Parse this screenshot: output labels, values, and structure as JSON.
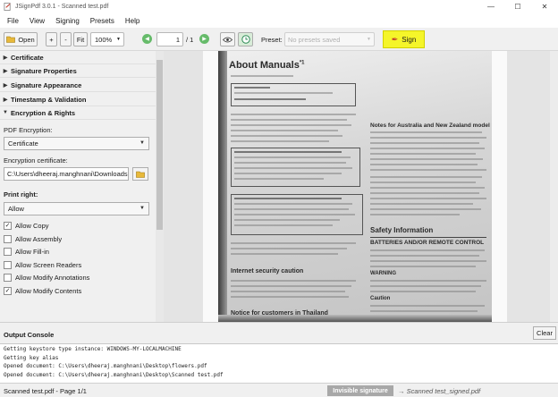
{
  "window": {
    "title": "JSignPdf 3.0.1 - Scanned test.pdf",
    "minimize": "—",
    "maximize": "☐",
    "close": "✕"
  },
  "menu": [
    "File",
    "View",
    "Signing",
    "Presets",
    "Help"
  ],
  "toolbar": {
    "open_label": "Open",
    "zoom_in": "+",
    "zoom_out": "-",
    "fit_label": "Fit",
    "zoom_value": "100%",
    "page_value": "1",
    "page_total": "/ 1",
    "preset_label": "Preset:",
    "preset_placeholder": "No presets saved",
    "sign_label": "Sign"
  },
  "sidebar": {
    "sections": [
      "Certificate",
      "Signature Properties",
      "Signature Appearance",
      "Timestamp & Validation",
      "Encryption & Rights"
    ],
    "pdf_encryption_label": "PDF Encryption:",
    "pdf_encryption_value": "Certificate",
    "enc_cert_label": "Encryption certificate:",
    "enc_cert_value": "C:\\Users\\dheeraj.manghnani\\Downloads",
    "print_right_label": "Print right:",
    "print_right_value": "Allow",
    "checkboxes": [
      {
        "label": "Allow Copy",
        "checked": true
      },
      {
        "label": "Allow Assembly",
        "checked": false
      },
      {
        "label": "Allow Fill-in",
        "checked": false
      },
      {
        "label": "Allow Screen Readers",
        "checked": false
      },
      {
        "label": "Allow Modify Annotations",
        "checked": false
      },
      {
        "label": "Allow Modify Contents",
        "checked": true
      }
    ]
  },
  "document": {
    "heading": "About Manuals",
    "heading_sup": "*1",
    "right_heading": "Notes for Australia and New Zealand model",
    "safety_heading": "Safety Information",
    "batteries_heading": "BATTERIES AND/OR REMOTE CONTROL",
    "warning_heading": "WARNING",
    "caution_heading": "Caution",
    "internet_heading": "Internet security caution",
    "thailand_heading": "Notice for customers in Thailand"
  },
  "console": {
    "title": "Output Console",
    "clear_label": "Clear",
    "lines": [
      "Getting keystore type instance: WINDOWS-MY-LOCALMACHINE",
      "Getting key alias",
      "Opened document: C:\\Users\\dheeraj.manghnani\\Desktop\\flowers.pdf",
      "Opened document: C:\\Users\\dheeraj.manghnani\\Desktop\\Scanned test.pdf"
    ]
  },
  "status": {
    "left": "Scanned test.pdf - Page 1/1",
    "badge": "Invisible signature",
    "output": "→ Scanned test_signed.pdf"
  },
  "colors": {
    "sign_highlight": "#f5f52a",
    "nav_green": "#4caf50",
    "badge_gray": "#a8a8a8"
  }
}
